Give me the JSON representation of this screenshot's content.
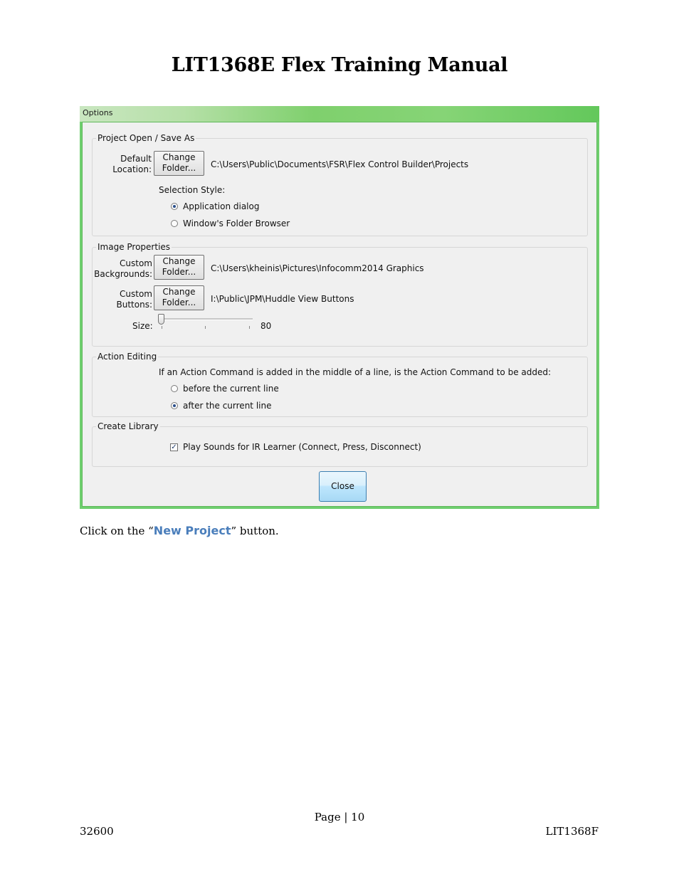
{
  "document": {
    "title": "LIT1368E Flex Training Manual",
    "instruction_prefix": "Click on the “",
    "instruction_link": "New Project",
    "instruction_suffix": "” button.",
    "footer_page": "Page | 10",
    "footer_left": "32600",
    "footer_right": "LIT1368F"
  },
  "dialog": {
    "title": "Options",
    "project_group": {
      "legend": "Project Open / Save As",
      "default_location_label_1": "Default",
      "default_location_label_2": "Location:",
      "change_folder_1": "Change",
      "change_folder_2": "Folder...",
      "default_location_path": "C:\\Users\\Public\\Documents\\FSR\\Flex Control Builder\\Projects",
      "selection_style_label": "Selection Style:",
      "options": [
        {
          "label": "Application dialog",
          "checked": true
        },
        {
          "label": "Window's Folder Browser",
          "checked": false
        }
      ]
    },
    "image_group": {
      "legend": "Image Properties",
      "backgrounds_label_1": "Custom",
      "backgrounds_label_2": "Backgrounds:",
      "backgrounds_path": "C:\\Users\\kheinis\\Pictures\\Infocomm2014 Graphics",
      "buttons_label_1": "Custom",
      "buttons_label_2": "Buttons:",
      "buttons_path": "I:\\Public\\JPM\\Huddle View Buttons",
      "change_folder_1": "Change",
      "change_folder_2": "Folder...",
      "size_label": "Size:",
      "size_value": "80",
      "size_fraction": 0.0
    },
    "action_group": {
      "legend": "Action Editing",
      "question": "If an Action Command is added in the middle of a line, is the Action Command to be added:",
      "options": [
        {
          "label": "before the current line",
          "checked": false
        },
        {
          "label": "after the current line",
          "checked": true
        }
      ]
    },
    "library_group": {
      "legend": "Create Library",
      "play_sounds_label": "Play Sounds for IR Learner (Connect, Press, Disconnect)",
      "play_sounds_checked": true
    },
    "close_label": "Close"
  }
}
